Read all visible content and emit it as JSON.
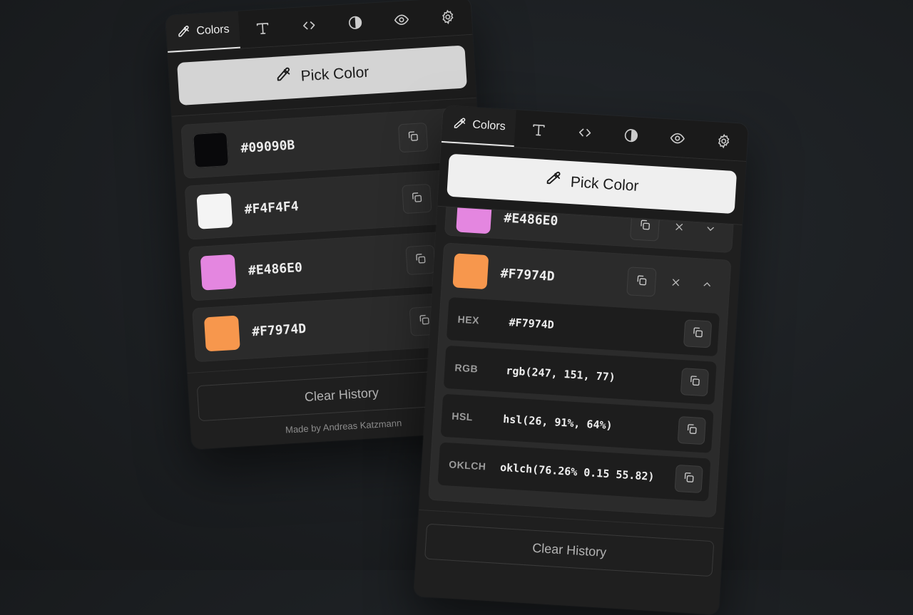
{
  "back_panel": {
    "tabs": {
      "colors_label": "Colors"
    },
    "pick_label": "Pick Color",
    "history": [
      {
        "hex": "#09090B",
        "color": "#09090b"
      },
      {
        "hex": "#F4F4F4",
        "color": "#f4f4f4"
      },
      {
        "hex": "#E486E0",
        "color": "#e486e0"
      },
      {
        "hex": "#F7974D",
        "color": "#f7974d"
      }
    ],
    "clear_label": "Clear History",
    "made_by": "Made by Andreas Katzmann"
  },
  "front_panel": {
    "tabs": {
      "colors_label": "Colors"
    },
    "pick_label": "Pick Color",
    "partial_item": {
      "hex": "#E486E0",
      "color": "#e486e0"
    },
    "expanded_item": {
      "hex": "#F7974D",
      "color": "#f7974d",
      "formats": [
        {
          "label": "HEX",
          "value": "#F7974D"
        },
        {
          "label": "RGB",
          "value": "rgb(247, 151, 77)"
        },
        {
          "label": "HSL",
          "value": "hsl(26, 91%, 64%)"
        },
        {
          "label": "OKLCH",
          "value": "oklch(76.26% 0.15 55.82)"
        }
      ]
    },
    "clear_label": "Clear History"
  },
  "icons": [
    "eyedropper-icon",
    "typography-icon",
    "code-icon",
    "contrast-icon",
    "eye-icon",
    "gear-icon",
    "copy-icon",
    "close-icon",
    "chevron-down-icon",
    "chevron-up-icon"
  ]
}
